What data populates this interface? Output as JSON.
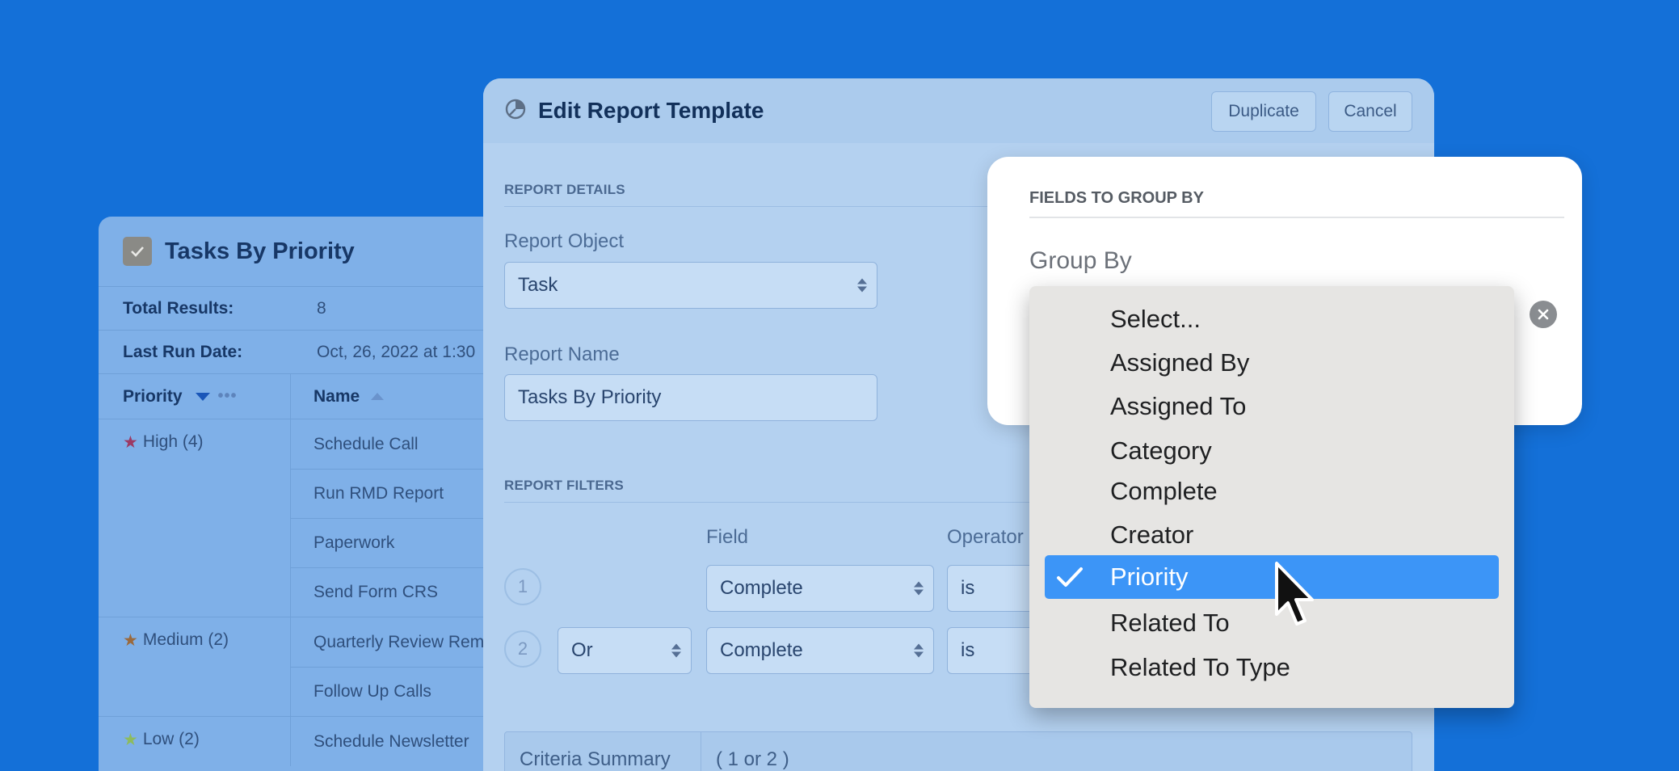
{
  "back_panel": {
    "title": "Tasks By Priority",
    "total_results_label": "Total Results:",
    "total_results_value": "8",
    "last_run_label": "Last Run Date:",
    "last_run_value": "Oct, 26, 2022 at 1:30",
    "col_priority": "Priority",
    "col_name": "Name",
    "groups": [
      {
        "label": "High (4)",
        "star_color": "#9c3a64",
        "names": [
          "Schedule Call",
          "Run RMD Report",
          "Paperwork",
          "Send Form CRS"
        ]
      },
      {
        "label": "Medium (2)",
        "star_color": "#9a6a3e",
        "names": [
          "Quarterly Review Rem",
          "Follow Up Calls"
        ]
      },
      {
        "label": "Low (2)",
        "star_color": "#8dbb5e",
        "names": [
          "Schedule Newsletter"
        ]
      }
    ]
  },
  "modal": {
    "title": "Edit Report Template",
    "duplicate_label": "Duplicate",
    "cancel_label": "Cancel",
    "report_details": "REPORT DETAILS",
    "report_object_label": "Report Object",
    "report_object_value": "Task",
    "report_name_label": "Report Name",
    "report_name_value": "Tasks By Priority",
    "report_filters": "REPORT FILTERS",
    "field_col": "Field",
    "operator_col": "Operator",
    "filters": [
      {
        "num": "1",
        "conj": "",
        "field": "Complete",
        "op": "is"
      },
      {
        "num": "2",
        "conj": "Or",
        "field": "Complete",
        "op": "is"
      }
    ],
    "criteria_label": "Criteria Summary",
    "criteria_value": "( 1 or 2 )"
  },
  "popover": {
    "section": "FIELDS TO GROUP BY",
    "group_by_label": "Group By"
  },
  "dropdown": {
    "selected": "Priority",
    "options": [
      "Select...",
      "Assigned By",
      "Assigned To",
      "Category",
      "Complete",
      "Creator",
      "Priority",
      "Related To",
      "Related To Type"
    ]
  },
  "colors": {
    "background": "#1470d8",
    "selected_option": "#3c95f7"
  }
}
